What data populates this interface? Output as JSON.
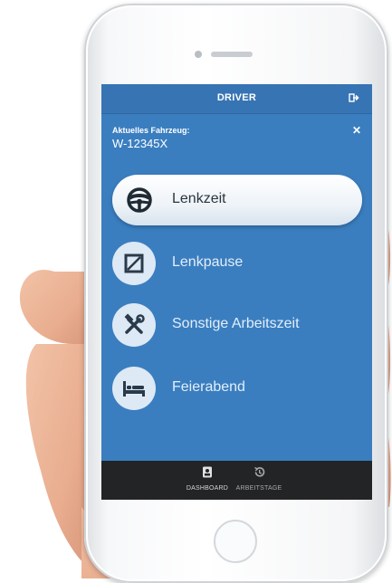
{
  "app": {
    "title": "DRIVER"
  },
  "vehicle": {
    "label": "Aktuelles Fahrzeug:",
    "value": "W-12345X"
  },
  "statuses": [
    {
      "label": "Lenkzeit",
      "icon": "steering-wheel-icon",
      "active": true
    },
    {
      "label": "Lenkpause",
      "icon": "pause-square-icon",
      "active": false
    },
    {
      "label": "Sonstige Arbeitszeit",
      "icon": "hammer-wrench-icon",
      "active": false
    },
    {
      "label": "Feierabend",
      "icon": "bed-icon",
      "active": false
    }
  ],
  "nav": [
    {
      "label": "DASHBOARD",
      "icon": "id-badge-icon"
    },
    {
      "label": "ARBEITSTAGE",
      "icon": "history-icon"
    }
  ],
  "colors": {
    "screen": "#3a7ec0",
    "topbar": "#3774b3",
    "nav": "#222425",
    "circle": "#dde9f5"
  }
}
